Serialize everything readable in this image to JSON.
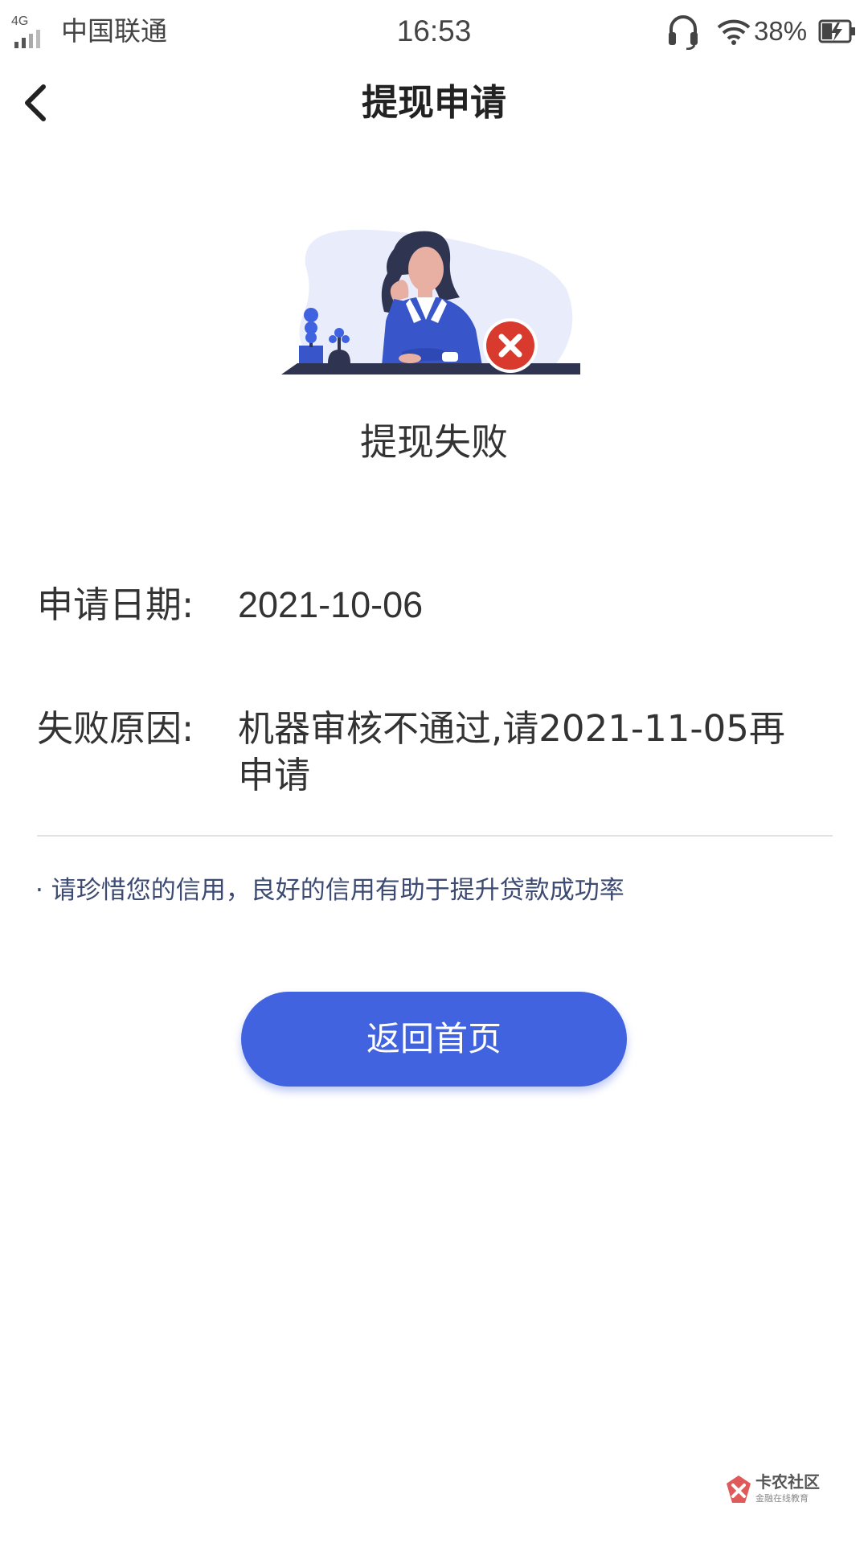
{
  "status_bar": {
    "network_type": "4G",
    "carrier": "中国联通",
    "time": "16:53",
    "battery_percent": "38%",
    "battery_level": 0.38,
    "icons": [
      "signal-icon",
      "headset-icon",
      "wifi-icon",
      "battery-charging-icon"
    ]
  },
  "header": {
    "back_icon": "chevron-left-icon",
    "title": "提现申请"
  },
  "result": {
    "illustration": "woman-at-desk-failed-illustration",
    "status_icon": "error-x-icon",
    "status_text": "提现失败"
  },
  "details": {
    "date_label": "申请日期:",
    "date_value": "2021-10-06",
    "reason_label": "失败原因:",
    "reason_value": "机器审核不通过,请2021-11-05再申请"
  },
  "tip": "· 请珍惜您的信用，良好的信用有助于提升贷款成功率",
  "actions": {
    "home_button_label": "返回首页"
  },
  "watermark": {
    "name": "卡农社区",
    "subtitle": "金融在线教育"
  },
  "colors": {
    "primary": "#4263e0",
    "error": "#d83a2e",
    "tip_text": "#3d4a72",
    "illustration_bg": "#e9ecfb"
  }
}
